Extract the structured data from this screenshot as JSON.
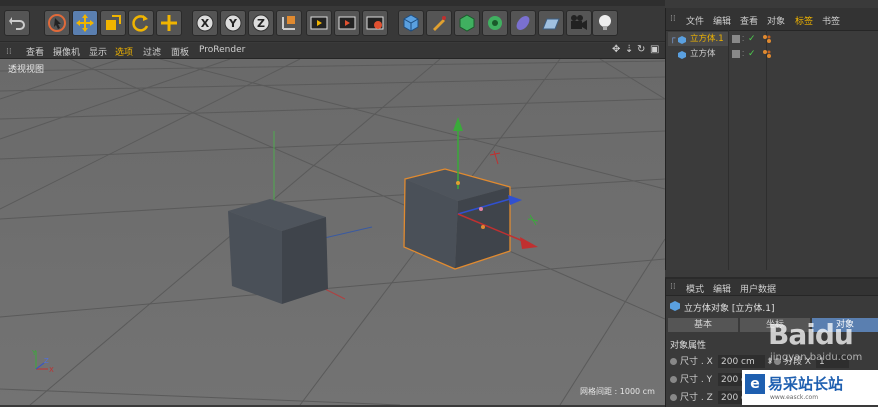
{
  "toolbar": {
    "icons": [
      "undo-icon",
      "select-icon",
      "move-icon",
      "scale-icon",
      "rotate-icon",
      "add-icon",
      "x-axis-icon",
      "y-axis-icon",
      "z-axis-icon",
      "coord-icon",
      "render-view-icon",
      "render-icon",
      "render-settings-icon",
      "cube-icon",
      "pen-icon",
      "subdivision-icon",
      "mograph-icon",
      "deformer-icon",
      "floor-icon",
      "camera-icon",
      "light-icon"
    ],
    "x_label": "X",
    "y_label": "Y",
    "z_label": "Z"
  },
  "viewport_menu": {
    "items": [
      "查看",
      "摄像机",
      "显示",
      "选项",
      "过滤",
      "面板",
      "ProRender"
    ],
    "highlight": "选项"
  },
  "viewport": {
    "name": "透视视图",
    "grid_spacing": "网格间距 : 1000 cm"
  },
  "object_manager": {
    "menu": [
      "文件",
      "编辑",
      "查看",
      "对象",
      "标签",
      "书签"
    ],
    "objects": [
      {
        "name": "立方体.1",
        "selected": true
      },
      {
        "name": "立方体",
        "selected": false
      }
    ]
  },
  "attribute_manager": {
    "menu": [
      "模式",
      "编辑",
      "用户数据"
    ],
    "title": "立方体对象 [立方体.1]",
    "tabs": [
      "基本",
      "坐标",
      "对象"
    ],
    "section": "对象属性",
    "fields": [
      {
        "label": "尺寸 . X",
        "value": "200 cm",
        "seg_label": "分段 X",
        "seg_value": "1"
      },
      {
        "label": "尺寸 . Y",
        "value": "200 cm",
        "seg_label": "",
        "seg_value": ""
      },
      {
        "label": "尺寸 . Z",
        "value": "200 cm",
        "seg_label": "",
        "seg_value": ""
      }
    ]
  },
  "watermark": {
    "baidu": "Baidu",
    "jingyan": "jingyan.baidu.com",
    "site": "易采站长站",
    "site_url": "www.easck.com"
  },
  "colors": {
    "accent": "#f0b400",
    "selection": "#5a7fb0",
    "grid": "#5c5c5c",
    "selected_cube_outline": "#e08a30"
  }
}
